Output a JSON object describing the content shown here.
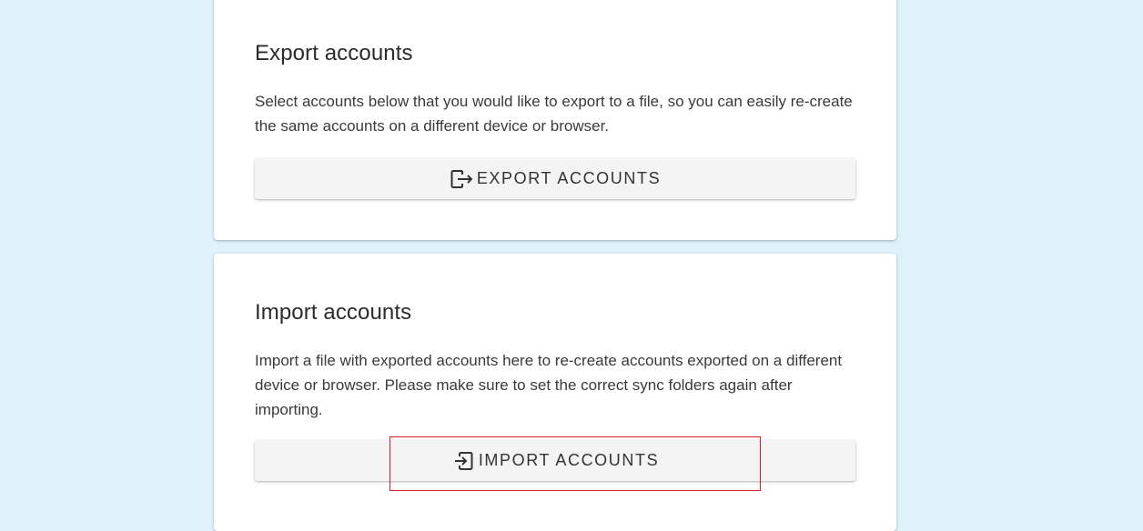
{
  "export_section": {
    "title": "Export accounts",
    "description": "Select accounts below that you would like to export to a file, so you can easily re-create the same accounts on a different device or browser.",
    "button_label": "EXPORT ACCOUNTS",
    "button_icon": "export-icon"
  },
  "import_section": {
    "title": "Import accounts",
    "description": "Import a file with exported accounts here to re-create accounts exported on a different device or browser. Please make sure to set the correct sync folders again after importing.",
    "button_label": "IMPORT ACCOUNTS",
    "button_icon": "import-icon"
  },
  "colors": {
    "page_background": "#dff2fc",
    "card_background": "#ffffff",
    "button_background": "#f4f4f4",
    "highlight_border": "#d81f26"
  }
}
